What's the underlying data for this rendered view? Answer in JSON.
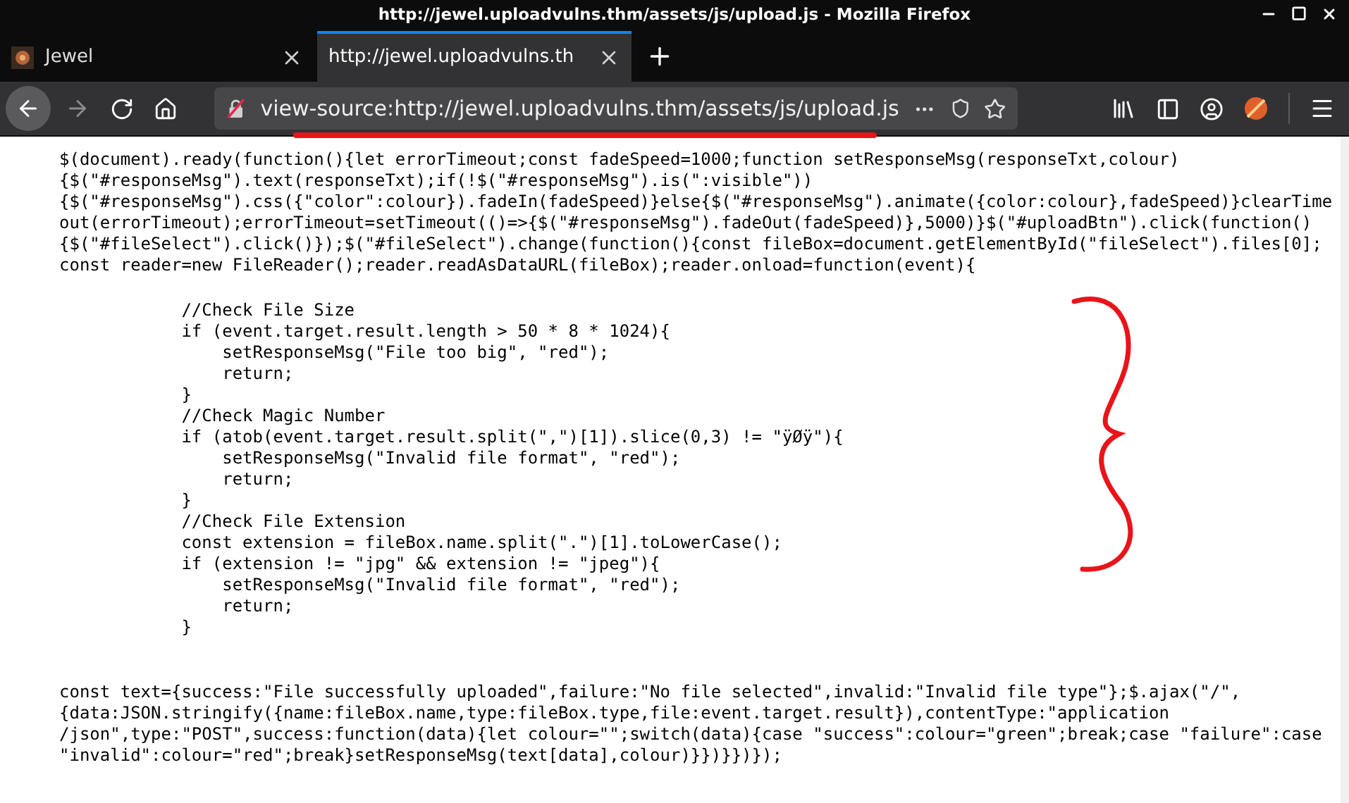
{
  "window": {
    "title": "http://jewel.uploadvulns.thm/assets/js/upload.js - Mozilla Firefox"
  },
  "tabs": [
    {
      "label": "Jewel",
      "selected": false
    },
    {
      "label": "http://jewel.uploadvulns.th",
      "selected": true
    }
  ],
  "address_bar": {
    "url": "view-source:http://jewel.uploadvulns.thm/assets/js/upload.js"
  },
  "source_blocks": [
    {
      "lines": [
        "$(document).ready(function(){let errorTimeout;const fadeSpeed=1000;function setResponseMsg(responseTxt,colour)",
        "{$(\"#responseMsg\").text(responseTxt);if(!$(\"#responseMsg\").is(\":visible\"))",
        "{$(\"#responseMsg\").css({\"color\":colour}).fadeIn(fadeSpeed)}else{$(\"#responseMsg\").animate({color:colour},fadeSpeed)}clearTime",
        "out(errorTimeout);errorTimeout=setTimeout(()=>{$(\"#responseMsg\").fadeOut(fadeSpeed)},5000)}$(\"#uploadBtn\").click(function()",
        "{$(\"#fileSelect\").click()});$(\"#fileSelect\").change(function(){const fileBox=document.getElementById(\"fileSelect\").files[0];",
        "const reader=new FileReader();reader.readAsDataURL(fileBox);reader.onload=function(event){"
      ]
    },
    {
      "lines": [
        "            //Check File Size",
        "            if (event.target.result.length > 50 * 8 * 1024){",
        "                setResponseMsg(\"File too big\", \"red\");",
        "                return;",
        "            }",
        "            //Check Magic Number",
        "            if (atob(event.target.result.split(\",\")[1]).slice(0,3) != \"ÿØÿ\"){",
        "                setResponseMsg(\"Invalid file format\", \"red\");",
        "                return;",
        "            }",
        "            //Check File Extension",
        "            const extension = fileBox.name.split(\".\")[1].toLowerCase();",
        "            if (extension != \"jpg\" && extension != \"jpeg\"){",
        "                setResponseMsg(\"Invalid file format\", \"red\");",
        "                return;",
        "            }"
      ]
    },
    {
      "lines": [
        "const text={success:\"File successfully uploaded\",failure:\"No file selected\",invalid:\"Invalid file type\"};$.ajax(\"/\",",
        "{data:JSON.stringify({name:fileBox.name,type:fileBox.type,file:event.target.result}),contentType:\"application",
        "/json\",type:\"POST\",success:function(data){let colour=\"\";switch(data){case \"success\":colour=\"green\";break;case \"failure\":case",
        "\"invalid\":colour=\"red\";break}setResponseMsg(text[data],colour)}})}})});"
      ]
    }
  ]
}
